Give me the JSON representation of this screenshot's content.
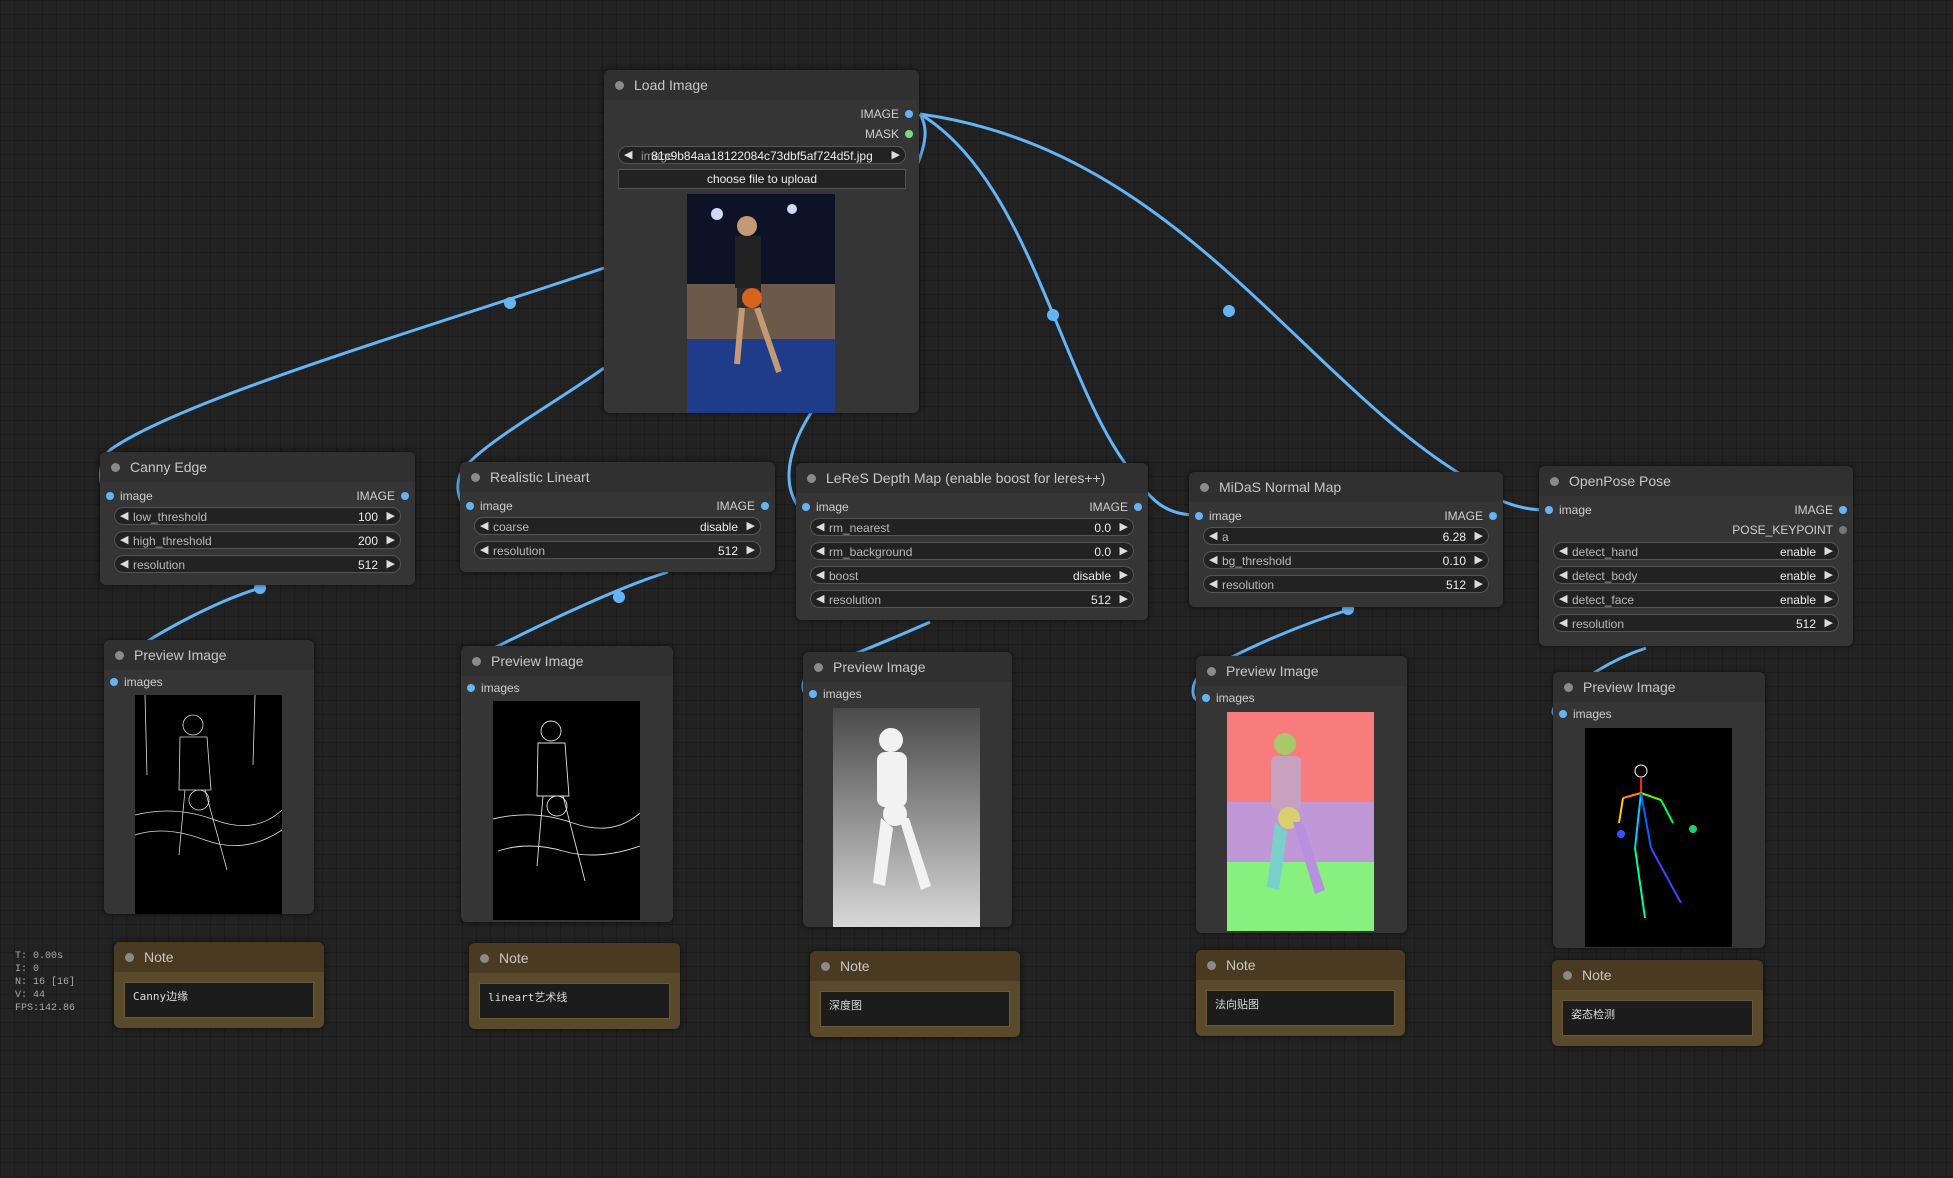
{
  "colors": {
    "wire": "#64b5f6",
    "canvas": "#222222",
    "node": "#353535",
    "note": "#5a4a2c"
  },
  "load_image": {
    "title": "Load Image",
    "outputs": [
      "IMAGE",
      "MASK"
    ],
    "image_label": "image",
    "image_value": "81c9b84aa18122084c73dbf5af724d5f.jpg",
    "upload_label": "choose file to upload"
  },
  "canny": {
    "title": "Canny Edge",
    "in": "image",
    "out": "IMAGE",
    "w1_name": "low_threshold",
    "w1_val": "100",
    "w2_name": "high_threshold",
    "w2_val": "200",
    "w3_name": "resolution",
    "w3_val": "512"
  },
  "lineart": {
    "title": "Realistic Lineart",
    "in": "image",
    "out": "IMAGE",
    "w1_name": "coarse",
    "w1_val": "disable",
    "w2_name": "resolution",
    "w2_val": "512"
  },
  "leres": {
    "title": "LeReS Depth Map (enable boost for leres++)",
    "in": "image",
    "out": "IMAGE",
    "w1_name": "rm_nearest",
    "w1_val": "0.0",
    "w2_name": "rm_background",
    "w2_val": "0.0",
    "w3_name": "boost",
    "w3_val": "disable",
    "w4_name": "resolution",
    "w4_val": "512"
  },
  "midas": {
    "title": "MiDaS Normal Map",
    "in": "image",
    "out": "IMAGE",
    "w1_name": "a",
    "w1_val": "6.28",
    "w2_name": "bg_threshold",
    "w2_val": "0.10",
    "w3_name": "resolution",
    "w3_val": "512"
  },
  "openpose": {
    "title": "OpenPose Pose",
    "in": "image",
    "out1": "IMAGE",
    "out2": "POSE_KEYPOINT",
    "w1_name": "detect_hand",
    "w1_val": "enable",
    "w2_name": "detect_body",
    "w2_val": "enable",
    "w3_name": "detect_face",
    "w3_val": "enable",
    "w4_name": "resolution",
    "w4_val": "512"
  },
  "preview": {
    "title": "Preview Image",
    "in": "images"
  },
  "notes": {
    "title": "Note",
    "canny": "Canny边缘",
    "lineart": "lineart艺术线",
    "depth": "深度图",
    "normal": "法向贴图",
    "pose": "姿态检测"
  },
  "stats": [
    "T: 0.00s",
    "I: 0",
    "N: 16 [16]",
    "V: 44",
    "FPS:142.86"
  ]
}
